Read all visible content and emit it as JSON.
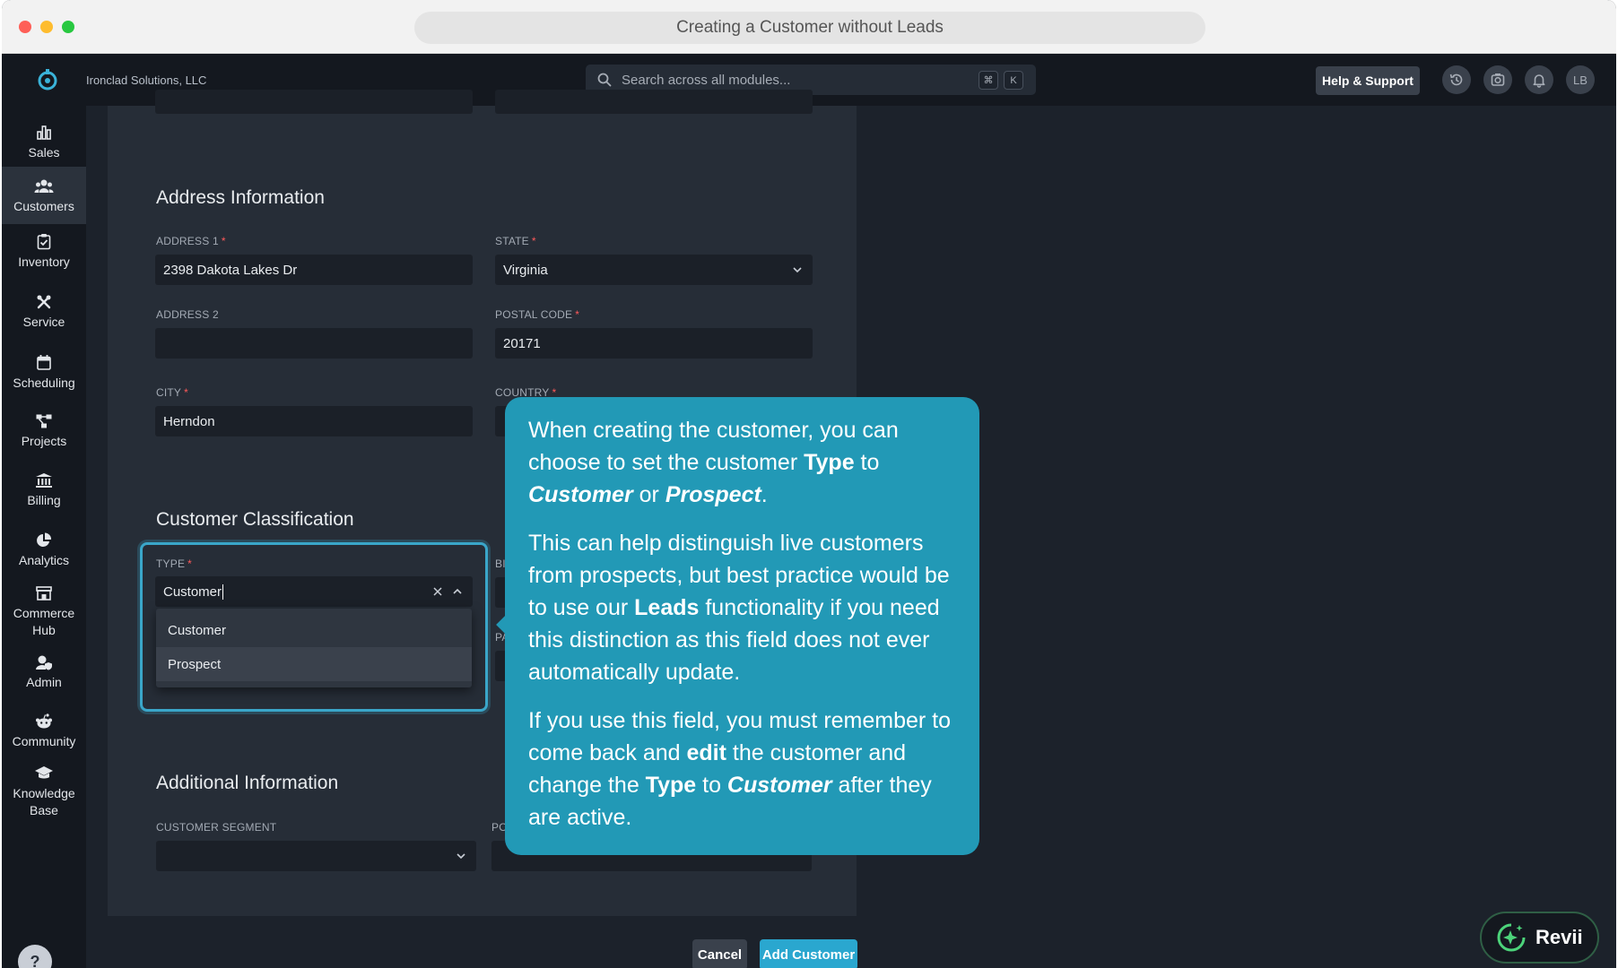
{
  "window": {
    "title": "Creating a Customer without Leads"
  },
  "header": {
    "company": "Ironclad Solutions, LLC",
    "search_placeholder": "Search across all modules...",
    "shortcut_keys": [
      "⌘",
      "K"
    ],
    "help_label": "Help & Support",
    "avatar_initials": "LB"
  },
  "sidebar": {
    "items": [
      {
        "label": "Sales",
        "icon": "chart-bar-icon"
      },
      {
        "label": "Customers",
        "icon": "users-icon",
        "active": true
      },
      {
        "label": "Inventory",
        "icon": "clipboard-check-icon"
      },
      {
        "label": "Service",
        "icon": "tools-icon"
      },
      {
        "label": "Scheduling",
        "icon": "calendar-icon"
      },
      {
        "label": "Projects",
        "icon": "project-diagram-icon"
      },
      {
        "label": "Billing",
        "icon": "bank-icon"
      },
      {
        "label": "Analytics",
        "icon": "pie-chart-icon"
      },
      {
        "label": "Commerce Hub",
        "icon": "store-icon"
      },
      {
        "label": "Admin",
        "icon": "user-shield-icon"
      },
      {
        "label": "Community",
        "icon": "reddit-icon"
      },
      {
        "label": "Knowledge Base",
        "icon": "graduation-cap-icon"
      }
    ],
    "help_glyph": "?"
  },
  "address": {
    "title": "Address Information",
    "address1_label": "ADDRESS 1",
    "address1_value": "2398 Dakota Lakes Dr",
    "state_label": "STATE",
    "state_value": "Virginia",
    "address2_label": "ADDRESS 2",
    "address2_value": "",
    "postal_label": "POSTAL CODE",
    "postal_value": "20171",
    "city_label": "CITY",
    "city_value": "Herndon",
    "country_label": "COUNTRY",
    "required_mark": "*"
  },
  "classification": {
    "title": "Customer Classification",
    "type_label": "TYPE",
    "type_value": "Customer",
    "options": [
      "Customer",
      "Prospect"
    ],
    "partial_labels": [
      "BI",
      "PA"
    ]
  },
  "additional": {
    "title": "Additional Information",
    "segment_label": "CUSTOMER SEGMENT",
    "partial_label": "PO"
  },
  "tooltip": {
    "p1_a": "When creating the customer, you can choose to set the customer ",
    "p1_type": "Type",
    "p1_b": " to ",
    "p1_customer": "Customer",
    "p1_c": " or ",
    "p1_prospect": "Prospect",
    "p1_d": ".",
    "p2_a": "This can help distinguish live customers from prospects, but best practice would be to use our ",
    "p2_leads": "Leads",
    "p2_b": " functionality if you need this distinction as this field does not ever automatically update.",
    "p3_a": "If you use this field, you must remember to come back and ",
    "p3_edit": "edit",
    "p3_b": " the customer and change the ",
    "p3_type": "Type",
    "p3_c": " to ",
    "p3_customer": "Customer",
    "p3_d": " after they are active."
  },
  "actions": {
    "cancel": "Cancel",
    "add": "Add Customer"
  },
  "assistant": {
    "label": "Revii"
  },
  "colors": {
    "accent": "#2aa7cf",
    "tooltip": "#2299b6",
    "required": "#ff5a5a"
  }
}
